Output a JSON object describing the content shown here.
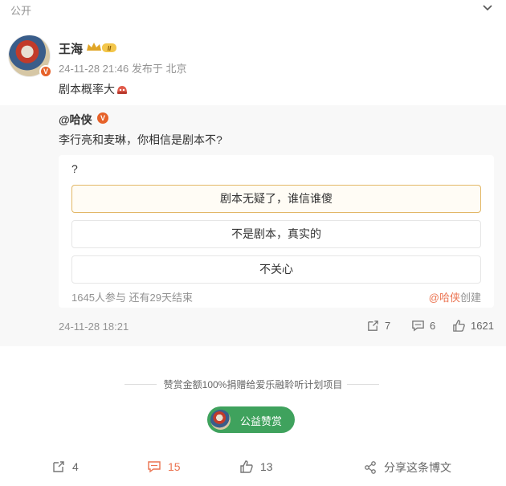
{
  "header": {
    "visibility": "公开"
  },
  "author": {
    "name": "王海",
    "verified_mark": "V",
    "level_mark": "II",
    "meta": "24-11-28 21:46 发布于 北京"
  },
  "post": {
    "text": "剧本概率大"
  },
  "repost": {
    "author": "@哈侠",
    "verified_mark": "V",
    "text": "李行亮和麦琳，你相信是剧本不?",
    "poll": {
      "question": "?",
      "options": [
        "剧本无疑了，谁信谁傻",
        "不是剧本，真实的",
        "不关心"
      ],
      "selected_index": 0,
      "stats": "1645人参与 还有29天结束",
      "creator_link": "@哈侠",
      "creator_suffix": "创建"
    },
    "time": "24-11-28 18:21",
    "actions": {
      "repost": "7",
      "comment": "6",
      "like": "1621"
    }
  },
  "reward": {
    "text": "赞赏金额100%捐赠给爱乐融聆听计划项目",
    "button_label": "公益赞赏"
  },
  "actions": {
    "repost": "4",
    "comment": "15",
    "like": "13",
    "share": "分享这条博文"
  },
  "colors": {
    "accent": "#eb7350",
    "reward_green": "#3fa25d",
    "selected_border": "#e2b766"
  }
}
